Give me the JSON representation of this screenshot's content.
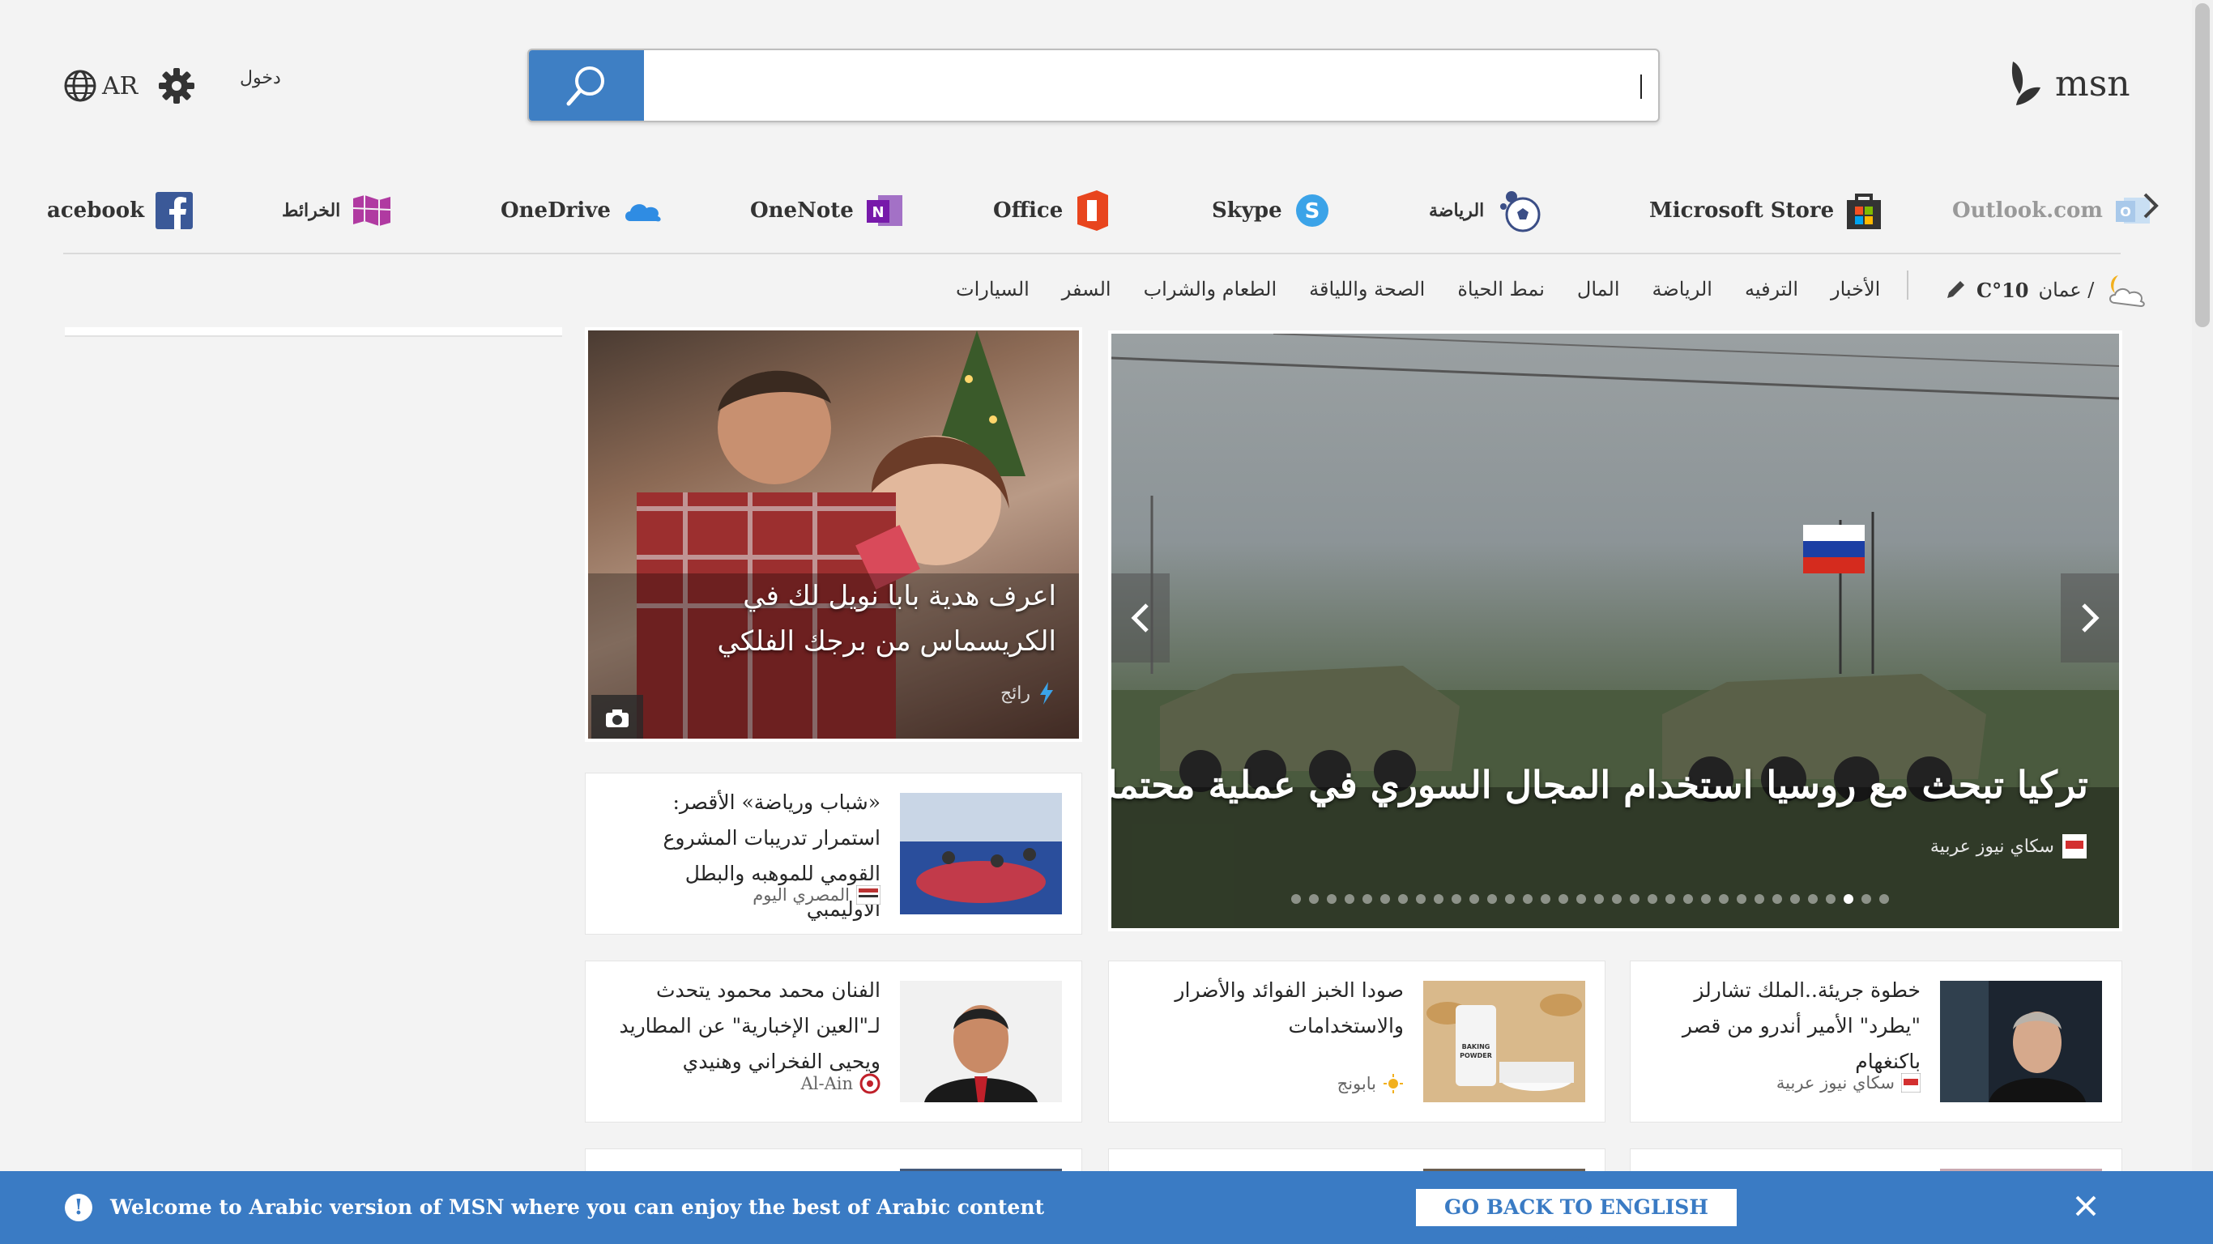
{
  "header": {
    "language": "AR",
    "signin": "دخول",
    "search": {
      "value": "",
      "placeholder": ""
    },
    "brand": "msn"
  },
  "quicklinks": {
    "items": [
      {
        "label": "Outlook.com",
        "icon": "outlook-icon"
      },
      {
        "label": "Microsoft Store",
        "icon": "store-icon"
      },
      {
        "label": "الرياضة",
        "icon": "sports-ball-icon"
      },
      {
        "label": "Skype",
        "icon": "skype-icon"
      },
      {
        "label": "Office",
        "icon": "office-icon"
      },
      {
        "label": "OneNote",
        "icon": "onenote-icon"
      },
      {
        "label": "OneDrive",
        "icon": "onedrive-icon"
      },
      {
        "label": "الخرائط",
        "icon": "maps-icon"
      },
      {
        "label": "acebook",
        "icon": "facebook-icon"
      }
    ]
  },
  "weather": {
    "location": "عمان / ",
    "temp": "C°10"
  },
  "nav": {
    "items": [
      "الأخبار",
      "الترفيه",
      "الرياضة",
      "المال",
      "نمط الحياة",
      "الصحة واللياقة",
      "الطعام والشراب",
      "السفر",
      "السيارات"
    ]
  },
  "hero": {
    "title": "تركيا تبحث مع روسيا استخدام المجال السوري في عملية محتملة",
    "source": "سكاي نيوز عربية",
    "slide_count": 34,
    "active_slide": 31
  },
  "feature": {
    "title": "اعرف هدية بابا نويل لك في الكريسماس من برجك الفلكي",
    "source": "رائج"
  },
  "cards": [
    {
      "title": "«شباب ورياضة» الأقصر: استمرار تدريبات المشروع القومي للموهبه والبطل الأوليمبي",
      "source": "المصري اليوم"
    },
    {
      "title": "الفنان محمد محمود يتحدث لـ\"العين الإخبارية\" عن المطاريد ويحيى الفخراني وهنيدي",
      "source": "Al-Ain"
    },
    {
      "title": "صودا الخبز الفوائد والأضرار والاستخدامات",
      "source": "بابونج",
      "thumb_label": "BAKING POWDER"
    },
    {
      "title": "خطوة جريئة..الملك تشارلز \"يطرد\" الأمير أندرو من قصر باكنغهام",
      "source": "سكاي نيوز عربية"
    }
  ],
  "banner": {
    "text": "Welcome to Arabic version of MSN where you can enjoy the best of Arabic content",
    "button": "GO BACK TO ENGLISH MSN"
  },
  "colors": {
    "accent": "#3a7bc4",
    "background": "#f3f3f3"
  }
}
